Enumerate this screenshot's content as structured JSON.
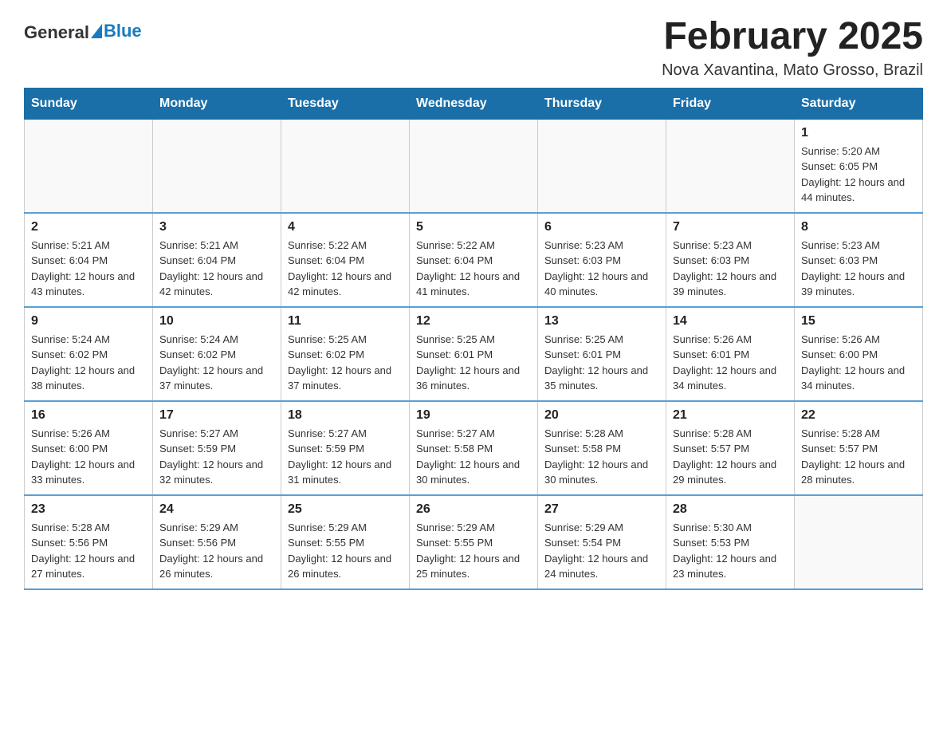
{
  "header": {
    "logo_general": "General",
    "logo_blue": "Blue",
    "title": "February 2025",
    "location": "Nova Xavantina, Mato Grosso, Brazil"
  },
  "weekdays": [
    "Sunday",
    "Monday",
    "Tuesday",
    "Wednesday",
    "Thursday",
    "Friday",
    "Saturday"
  ],
  "weeks": [
    [
      {
        "day": "",
        "info": ""
      },
      {
        "day": "",
        "info": ""
      },
      {
        "day": "",
        "info": ""
      },
      {
        "day": "",
        "info": ""
      },
      {
        "day": "",
        "info": ""
      },
      {
        "day": "",
        "info": ""
      },
      {
        "day": "1",
        "info": "Sunrise: 5:20 AM\nSunset: 6:05 PM\nDaylight: 12 hours and 44 minutes."
      }
    ],
    [
      {
        "day": "2",
        "info": "Sunrise: 5:21 AM\nSunset: 6:04 PM\nDaylight: 12 hours and 43 minutes."
      },
      {
        "day": "3",
        "info": "Sunrise: 5:21 AM\nSunset: 6:04 PM\nDaylight: 12 hours and 42 minutes."
      },
      {
        "day": "4",
        "info": "Sunrise: 5:22 AM\nSunset: 6:04 PM\nDaylight: 12 hours and 42 minutes."
      },
      {
        "day": "5",
        "info": "Sunrise: 5:22 AM\nSunset: 6:04 PM\nDaylight: 12 hours and 41 minutes."
      },
      {
        "day": "6",
        "info": "Sunrise: 5:23 AM\nSunset: 6:03 PM\nDaylight: 12 hours and 40 minutes."
      },
      {
        "day": "7",
        "info": "Sunrise: 5:23 AM\nSunset: 6:03 PM\nDaylight: 12 hours and 39 minutes."
      },
      {
        "day": "8",
        "info": "Sunrise: 5:23 AM\nSunset: 6:03 PM\nDaylight: 12 hours and 39 minutes."
      }
    ],
    [
      {
        "day": "9",
        "info": "Sunrise: 5:24 AM\nSunset: 6:02 PM\nDaylight: 12 hours and 38 minutes."
      },
      {
        "day": "10",
        "info": "Sunrise: 5:24 AM\nSunset: 6:02 PM\nDaylight: 12 hours and 37 minutes."
      },
      {
        "day": "11",
        "info": "Sunrise: 5:25 AM\nSunset: 6:02 PM\nDaylight: 12 hours and 37 minutes."
      },
      {
        "day": "12",
        "info": "Sunrise: 5:25 AM\nSunset: 6:01 PM\nDaylight: 12 hours and 36 minutes."
      },
      {
        "day": "13",
        "info": "Sunrise: 5:25 AM\nSunset: 6:01 PM\nDaylight: 12 hours and 35 minutes."
      },
      {
        "day": "14",
        "info": "Sunrise: 5:26 AM\nSunset: 6:01 PM\nDaylight: 12 hours and 34 minutes."
      },
      {
        "day": "15",
        "info": "Sunrise: 5:26 AM\nSunset: 6:00 PM\nDaylight: 12 hours and 34 minutes."
      }
    ],
    [
      {
        "day": "16",
        "info": "Sunrise: 5:26 AM\nSunset: 6:00 PM\nDaylight: 12 hours and 33 minutes."
      },
      {
        "day": "17",
        "info": "Sunrise: 5:27 AM\nSunset: 5:59 PM\nDaylight: 12 hours and 32 minutes."
      },
      {
        "day": "18",
        "info": "Sunrise: 5:27 AM\nSunset: 5:59 PM\nDaylight: 12 hours and 31 minutes."
      },
      {
        "day": "19",
        "info": "Sunrise: 5:27 AM\nSunset: 5:58 PM\nDaylight: 12 hours and 30 minutes."
      },
      {
        "day": "20",
        "info": "Sunrise: 5:28 AM\nSunset: 5:58 PM\nDaylight: 12 hours and 30 minutes."
      },
      {
        "day": "21",
        "info": "Sunrise: 5:28 AM\nSunset: 5:57 PM\nDaylight: 12 hours and 29 minutes."
      },
      {
        "day": "22",
        "info": "Sunrise: 5:28 AM\nSunset: 5:57 PM\nDaylight: 12 hours and 28 minutes."
      }
    ],
    [
      {
        "day": "23",
        "info": "Sunrise: 5:28 AM\nSunset: 5:56 PM\nDaylight: 12 hours and 27 minutes."
      },
      {
        "day": "24",
        "info": "Sunrise: 5:29 AM\nSunset: 5:56 PM\nDaylight: 12 hours and 26 minutes."
      },
      {
        "day": "25",
        "info": "Sunrise: 5:29 AM\nSunset: 5:55 PM\nDaylight: 12 hours and 26 minutes."
      },
      {
        "day": "26",
        "info": "Sunrise: 5:29 AM\nSunset: 5:55 PM\nDaylight: 12 hours and 25 minutes."
      },
      {
        "day": "27",
        "info": "Sunrise: 5:29 AM\nSunset: 5:54 PM\nDaylight: 12 hours and 24 minutes."
      },
      {
        "day": "28",
        "info": "Sunrise: 5:30 AM\nSunset: 5:53 PM\nDaylight: 12 hours and 23 minutes."
      },
      {
        "day": "",
        "info": ""
      }
    ]
  ]
}
